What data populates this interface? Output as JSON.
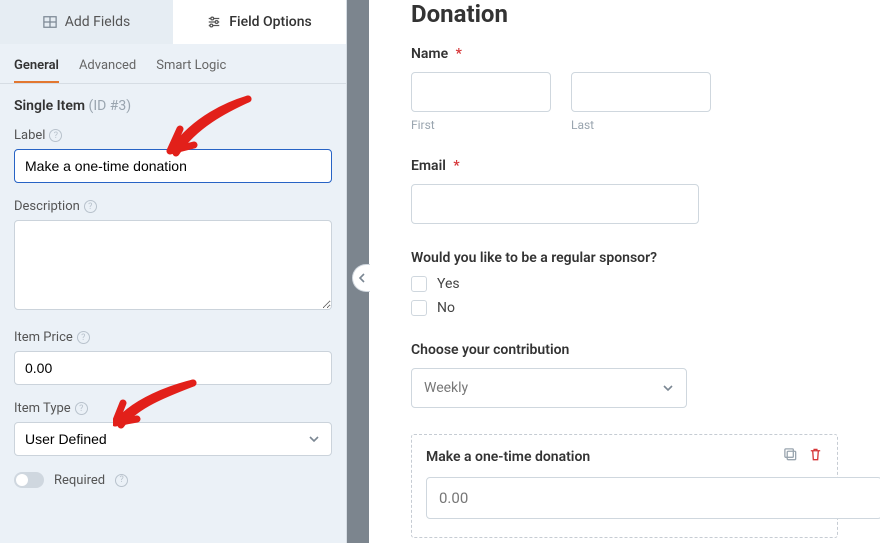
{
  "sidebar": {
    "topTabs": {
      "addFields": "Add Fields",
      "fieldOptions": "Field Options"
    },
    "subTabs": {
      "general": "General",
      "advanced": "Advanced",
      "smartLogic": "Smart Logic"
    },
    "singleItem": {
      "title": "Single Item",
      "id": "(ID #3)"
    },
    "labelField": {
      "label": "Label",
      "value": "Make a one-time donation"
    },
    "descriptionField": {
      "label": "Description",
      "value": ""
    },
    "itemPrice": {
      "label": "Item Price",
      "value": "0.00"
    },
    "itemType": {
      "label": "Item Type",
      "value": "User Defined"
    },
    "required": {
      "label": "Required"
    }
  },
  "preview": {
    "title": "Donation",
    "name": {
      "label": "Name",
      "required": "*",
      "first": "First",
      "last": "Last"
    },
    "email": {
      "label": "Email",
      "required": "*"
    },
    "sponsor": {
      "label": "Would you like to be a regular sponsor?",
      "yes": "Yes",
      "no": "No"
    },
    "contribution": {
      "label": "Choose your contribution",
      "value": "Weekly"
    },
    "selected": {
      "label": "Make a one-time donation",
      "value": "0.00"
    }
  }
}
